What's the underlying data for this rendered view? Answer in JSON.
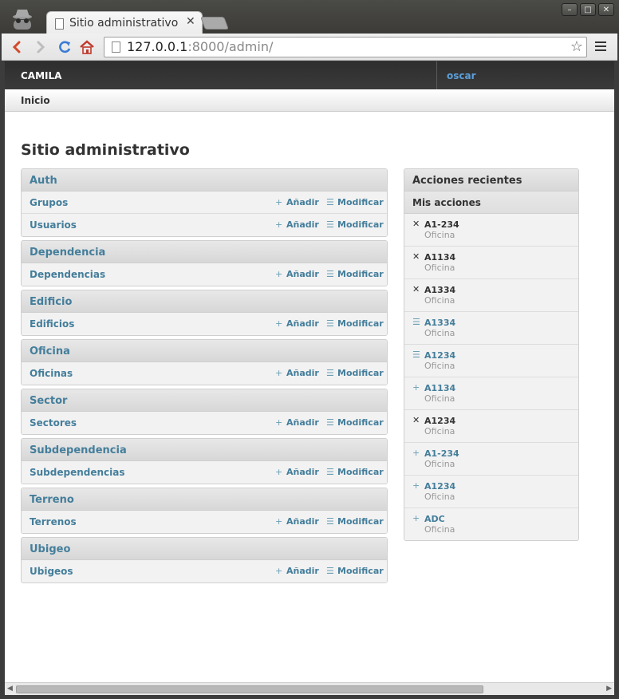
{
  "browser": {
    "tab_title": "Sitio administrativo | Sitio",
    "tab_close": "✕",
    "url_host": "127.0.0.1",
    "url_rest": ":8000/admin/",
    "window_buttons": [
      "–",
      "□",
      "✕"
    ],
    "star": "☆"
  },
  "header": {
    "site_name": "CAMILA",
    "user": "oscar"
  },
  "breadcrumbs": {
    "home": "Inicio"
  },
  "page_title": "Sitio administrativo",
  "labels": {
    "add": "Añadir",
    "change": "Modificar",
    "add_glyph": "+",
    "change_glyph": "☰"
  },
  "apps": [
    {
      "name": "Auth",
      "models": [
        "Grupos",
        "Usuarios"
      ]
    },
    {
      "name": "Dependencia",
      "models": [
        "Dependencias"
      ]
    },
    {
      "name": "Edificio",
      "models": [
        "Edificios"
      ]
    },
    {
      "name": "Oficina",
      "models": [
        "Oficinas"
      ]
    },
    {
      "name": "Sector",
      "models": [
        "Sectores"
      ]
    },
    {
      "name": "Subdependencia",
      "models": [
        "Subdependencias"
      ]
    },
    {
      "name": "Terreno",
      "models": [
        "Terrenos"
      ]
    },
    {
      "name": "Ubigeo",
      "models": [
        "Ubigeos"
      ]
    }
  ],
  "recent": {
    "title": "Acciones recientes",
    "subtitle": "Mis acciones",
    "actions": [
      {
        "kind": "deleted",
        "icon": "✕",
        "name": "A1-234",
        "type": "Oficina"
      },
      {
        "kind": "deleted",
        "icon": "✕",
        "name": "A1134",
        "type": "Oficina"
      },
      {
        "kind": "deleted",
        "icon": "✕",
        "name": "A1334",
        "type": "Oficina"
      },
      {
        "kind": "changed",
        "icon": "☰",
        "name": "A1334",
        "type": "Oficina"
      },
      {
        "kind": "changed",
        "icon": "☰",
        "name": "A1234",
        "type": "Oficina"
      },
      {
        "kind": "added",
        "icon": "+",
        "name": "A1134",
        "type": "Oficina"
      },
      {
        "kind": "deleted",
        "icon": "✕",
        "name": "A1234",
        "type": "Oficina"
      },
      {
        "kind": "added",
        "icon": "+",
        "name": "A1-234",
        "type": "Oficina"
      },
      {
        "kind": "added",
        "icon": "+",
        "name": "A1234",
        "type": "Oficina"
      },
      {
        "kind": "added",
        "icon": "+",
        "name": "ADC",
        "type": "Oficina"
      }
    ]
  }
}
